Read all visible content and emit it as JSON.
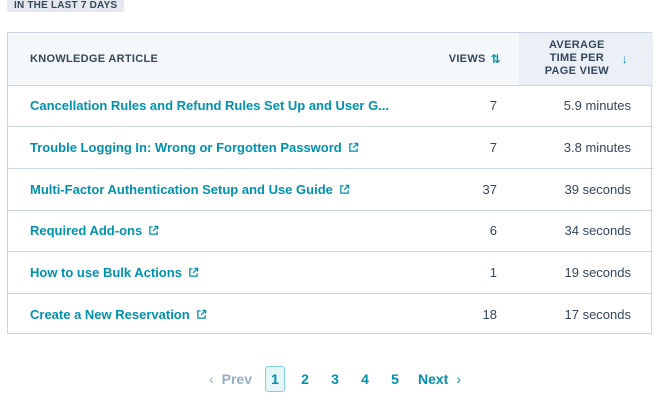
{
  "header": {
    "date_range_tag": "IN THE LAST 7 DAYS"
  },
  "table": {
    "columns": {
      "article": "KNOWLEDGE ARTICLE",
      "views": "VIEWS",
      "time": "AVERAGE TIME PER PAGE VIEW"
    },
    "rows": [
      {
        "title": "Cancellation Rules and Refund Rules Set Up and User G...",
        "views": "7",
        "time": "5.9 minutes",
        "external": false
      },
      {
        "title": "Trouble Logging In: Wrong or Forgotten Password",
        "views": "7",
        "time": "3.8 minutes",
        "external": true
      },
      {
        "title": "Multi-Factor Authentication Setup and Use Guide",
        "views": "37",
        "time": "39 seconds",
        "external": true
      },
      {
        "title": "Required Add-ons",
        "views": "6",
        "time": "34 seconds",
        "external": true
      },
      {
        "title": "How to use Bulk Actions",
        "views": "1",
        "time": "19 seconds",
        "external": true
      },
      {
        "title": "Create a New Reservation",
        "views": "18",
        "time": "17 seconds",
        "external": true
      }
    ]
  },
  "pagination": {
    "prev": "Prev",
    "next": "Next",
    "pages": [
      "1",
      "2",
      "3",
      "4",
      "5"
    ],
    "current": "1"
  },
  "colors": {
    "link": "#0091ae",
    "text": "#33475b",
    "border": "#cbd6e2",
    "header_bg": "#f5f8fa",
    "sorted_col_bg": "#eaf0f6"
  },
  "icons": {
    "views_sort": "sort-both-icon",
    "time_sort": "sort-descending-icon",
    "external": "external-link-icon"
  }
}
